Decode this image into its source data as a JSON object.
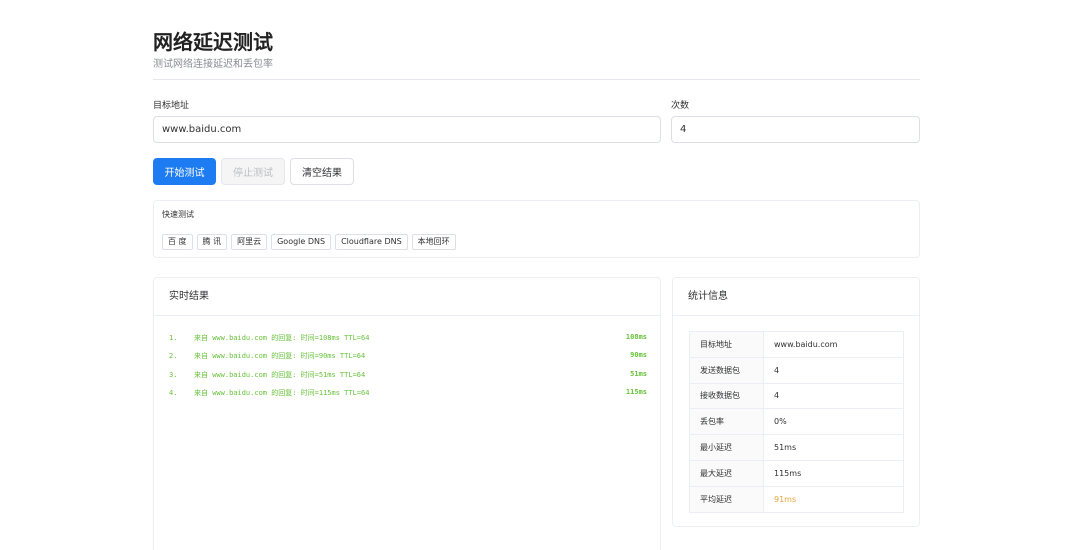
{
  "page": {
    "title": "网络延迟测试",
    "subtitle": "测试网络连接延迟和丢包率"
  },
  "form": {
    "target_label": "目标地址",
    "target_value": "www.baidu.com",
    "count_label": "次数",
    "count_value": "4"
  },
  "buttons": {
    "start": "开始测试",
    "stop": "停止测试",
    "clear": "清空结果"
  },
  "quick": {
    "title": "快速测试",
    "items": [
      "百 度",
      "腾 讯",
      "阿里云",
      "Google DNS",
      "Cloudflare DNS",
      "本地回环"
    ]
  },
  "results": {
    "title": "实时结果",
    "rows": [
      {
        "num": "1.",
        "text": "来自 www.baidu.com 的回复: 时间=108ms TTL=64",
        "ms": "108ms"
      },
      {
        "num": "2.",
        "text": "来自 www.baidu.com 的回复: 时间=90ms TTL=64",
        "ms": "90ms"
      },
      {
        "num": "3.",
        "text": "来自 www.baidu.com 的回复: 时间=51ms TTL=64",
        "ms": "51ms"
      },
      {
        "num": "4.",
        "text": "来自 www.baidu.com 的回复: 时间=115ms TTL=64",
        "ms": "115ms"
      }
    ]
  },
  "stats": {
    "title": "统计信息",
    "rows": [
      {
        "key": "目标地址",
        "value": "www.baidu.com"
      },
      {
        "key": "发送数据包",
        "value": "4"
      },
      {
        "key": "接收数据包",
        "value": "4"
      },
      {
        "key": "丢包率",
        "value": "0%"
      },
      {
        "key": "最小延迟",
        "value": "51ms"
      },
      {
        "key": "最大延迟",
        "value": "115ms"
      },
      {
        "key": "平均延迟",
        "value": "91ms"
      }
    ]
  },
  "colors": {
    "primary": "#1e7cf2",
    "success_text": "#67c23a",
    "warning_text": "#e6a23c"
  }
}
